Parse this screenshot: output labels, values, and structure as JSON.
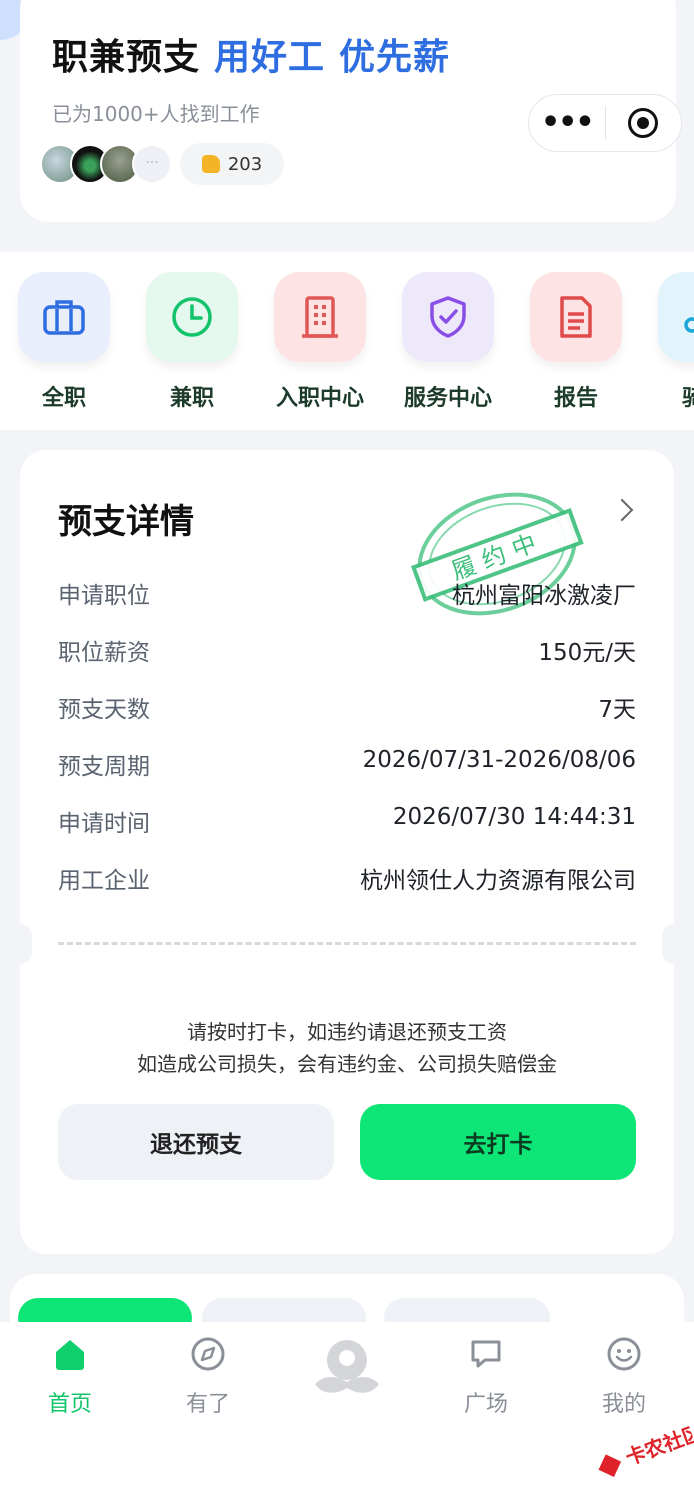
{
  "header": {
    "title_main": "职兼预支",
    "title_tag1": "用好工",
    "title_tag2": "优先薪",
    "subtitle": "已为1000+人找到工作",
    "more_avatars": "···",
    "likes_count": "203"
  },
  "capsule": {
    "more_glyph": "•••"
  },
  "menu": {
    "items": [
      {
        "label": "全职",
        "icon": "briefcase-icon"
      },
      {
        "label": "兼职",
        "icon": "clock-icon"
      },
      {
        "label": "入职中心",
        "icon": "building-icon"
      },
      {
        "label": "服务中心",
        "icon": "shield-check-icon"
      },
      {
        "label": "报告",
        "icon": "document-icon"
      },
      {
        "label": "骑手",
        "icon": "rider-icon"
      }
    ]
  },
  "detail": {
    "title": "预支详情",
    "stamp_text": "履约中",
    "rows": [
      {
        "key": "申请职位",
        "value": "杭州富阳冰激凌厂"
      },
      {
        "key": "职位薪资",
        "value": "150元/天"
      },
      {
        "key": "预支天数",
        "value": "7天"
      },
      {
        "key": "预支周期",
        "value": "2026/07/31-2026/08/06"
      },
      {
        "key": "申请时间",
        "value": "2026/07/30 14:44:31"
      },
      {
        "key": "用工企业",
        "value": "杭州领仕人力资源有限公司"
      }
    ],
    "notice_line1": "请按时打卡，如违约请退还预支工资",
    "notice_line2": "如造成公司损失，会有违约金、公司损失赔偿金",
    "btn_return": "退还预支",
    "btn_clock": "去打卡"
  },
  "tabbar": {
    "items": [
      {
        "label": "首页",
        "icon": "home-icon",
        "active": true
      },
      {
        "label": "有了",
        "icon": "compass-icon",
        "active": false
      },
      {
        "label": "",
        "icon": "mascot-icon",
        "active": false
      },
      {
        "label": "广场",
        "icon": "chat-icon",
        "active": false
      },
      {
        "label": "我的",
        "icon": "smile-icon",
        "active": false
      }
    ]
  },
  "watermark": {
    "text": "卡农社区"
  },
  "colors": {
    "accent": "#0de676",
    "brand_blue": "#2f6ee0",
    "active_tab": "#10c56a",
    "stamp_green": "#3bbf7a"
  }
}
